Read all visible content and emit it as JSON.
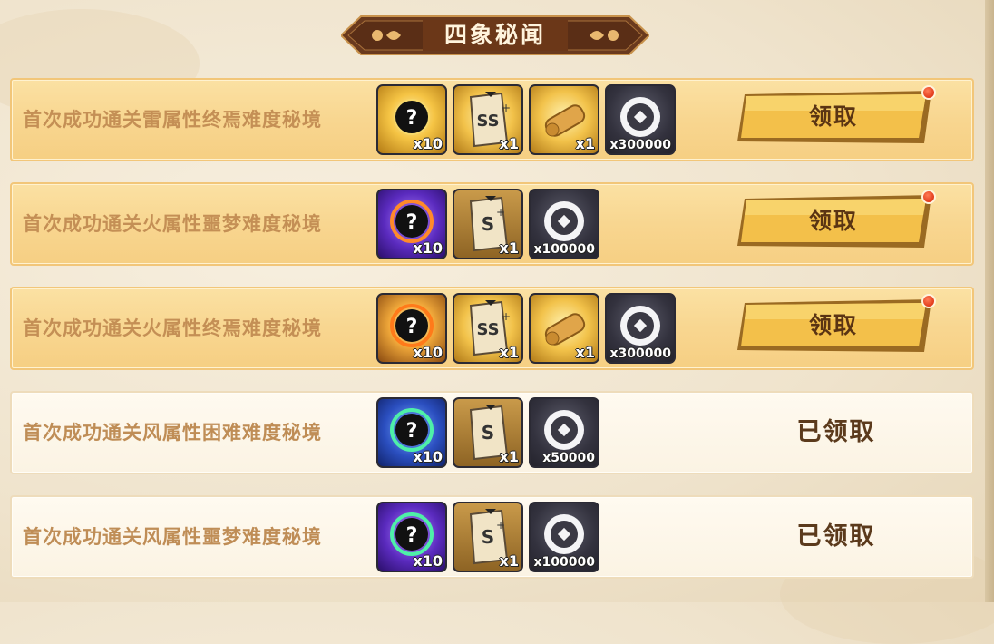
{
  "panel": {
    "title": "四象秘闻"
  },
  "colors": {
    "claim_row_bg": "#f8d690",
    "done_row_bg": "#fbf3e3",
    "button_gold": "#f2c24a",
    "label_brown": "#c48f55",
    "notification_red": "#e23b1c"
  },
  "rows": [
    {
      "task": "首次成功通关雷属性终焉难度秘境",
      "state": "claimable",
      "action_label": "领取",
      "rewards": [
        {
          "icon": "mystery-orb-gold-icon",
          "count": "x10"
        },
        {
          "icon": "ss-plus-scroll-icon",
          "count": "x1"
        },
        {
          "icon": "golden-scroll-icon",
          "count": "x1"
        },
        {
          "icon": "copper-coin-icon",
          "count": "x300000"
        }
      ]
    },
    {
      "task": "首次成功通关火属性噩梦难度秘境",
      "state": "claimable",
      "action_label": "领取",
      "rewards": [
        {
          "icon": "mystery-orb-purple-fire-icon",
          "count": "x10"
        },
        {
          "icon": "s-plus-scroll-icon",
          "count": "x1"
        },
        {
          "icon": "copper-coin-icon",
          "count": "x100000"
        }
      ]
    },
    {
      "task": "首次成功通关火属性终焉难度秘境",
      "state": "claimable",
      "action_label": "领取",
      "rewards": [
        {
          "icon": "mystery-orb-fire-icon",
          "count": "x10"
        },
        {
          "icon": "ss-plus-scroll-icon",
          "count": "x1"
        },
        {
          "icon": "golden-scroll-icon",
          "count": "x1"
        },
        {
          "icon": "copper-coin-icon",
          "count": "x300000"
        }
      ]
    },
    {
      "task": "首次成功通关风属性困难难度秘境",
      "state": "claimed",
      "action_label": "已领取",
      "rewards": [
        {
          "icon": "mystery-orb-blue-wind-icon",
          "count": "x10"
        },
        {
          "icon": "s-scroll-icon",
          "count": "x1"
        },
        {
          "icon": "copper-coin-icon",
          "count": "x50000"
        }
      ]
    },
    {
      "task": "首次成功通关风属性噩梦难度秘境",
      "state": "claimed",
      "action_label": "已领取",
      "rewards": [
        {
          "icon": "mystery-orb-purple-wind-icon",
          "count": "x10"
        },
        {
          "icon": "s-plus-scroll-icon",
          "count": "x1"
        },
        {
          "icon": "copper-coin-icon",
          "count": "x100000"
        }
      ]
    }
  ]
}
